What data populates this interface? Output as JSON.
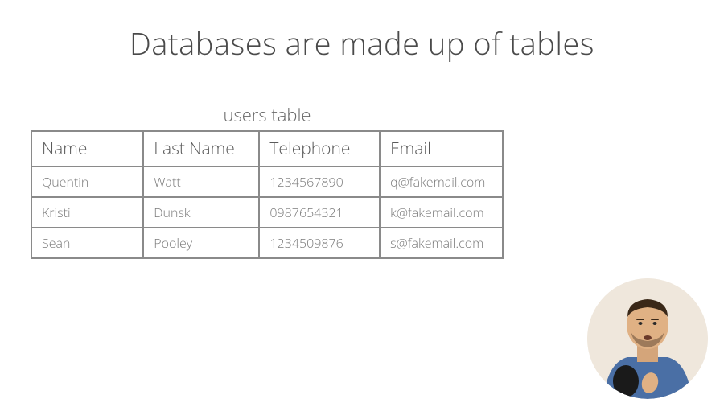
{
  "title": "Databases are made up of tables",
  "table": {
    "label": "users table",
    "headers": [
      "Name",
      "Last Name",
      "Telephone",
      "Email"
    ],
    "rows": [
      [
        "Quentin",
        "Watt",
        "1234567890",
        "q@fakemail.com"
      ],
      [
        "Kristi",
        "Dunsk",
        "0987654321",
        "k@fakemail.com"
      ],
      [
        "Sean",
        "Pooley",
        "1234509876",
        "s@fakemail.com"
      ]
    ]
  }
}
